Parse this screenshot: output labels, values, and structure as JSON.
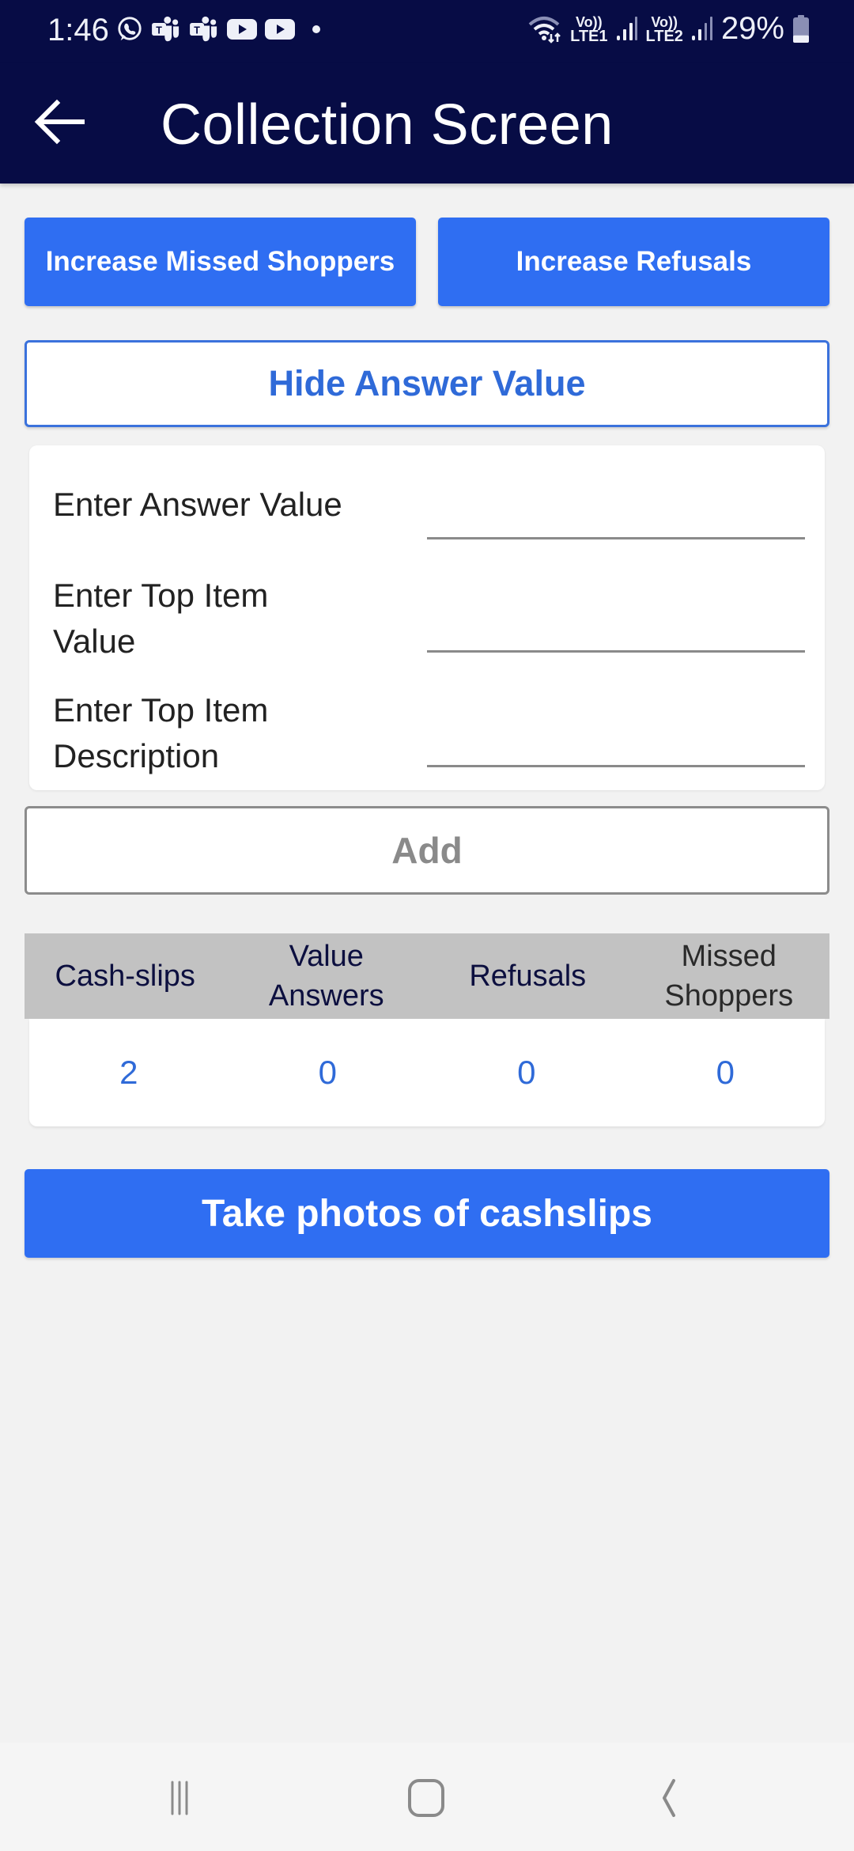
{
  "status_bar": {
    "time": "1:46",
    "notification_icons": [
      "whatsapp-icon",
      "teams-icon",
      "teams-icon",
      "youtube-icon",
      "youtube-icon",
      "more-notifications-dot"
    ],
    "wifi_icon": "wifi-icon",
    "sim1": {
      "top": "Vo))",
      "bottom": "LTE1"
    },
    "sim2": {
      "top": "Vo))",
      "bottom": "LTE2"
    },
    "battery_percent": "29%",
    "battery_level": 0.29
  },
  "app_bar": {
    "back_icon": "arrow-left-icon",
    "title": "Collection Screen"
  },
  "actions": {
    "increase_missed_shoppers": "Increase Missed Shoppers",
    "increase_refusals": "Increase Refusals",
    "hide_answer_value": "Hide Answer Value",
    "add": "Add",
    "take_photos": "Take photos of cashslips"
  },
  "form": {
    "fields": [
      {
        "label": "Enter Answer Value",
        "value": ""
      },
      {
        "label_line1": "Enter Top Item",
        "label_line2": "Value",
        "value": ""
      },
      {
        "label_line1": "Enter Top Item",
        "label_line2": "Description",
        "value": ""
      }
    ]
  },
  "stats": {
    "headers": [
      {
        "line1": "Cash-slips",
        "line2": ""
      },
      {
        "line1": "Value",
        "line2": "Answers"
      },
      {
        "line1": "Refusals",
        "line2": ""
      },
      {
        "line1": "Missed",
        "line2": "Shoppers"
      }
    ],
    "values": [
      "2",
      "0",
      "0",
      "0"
    ]
  },
  "colors": {
    "app_bar": "#070c45",
    "primary_button": "#2f6ef2",
    "accent_text": "#2f6ad8",
    "table_header": "#c2c2c2",
    "background": "#f2f2f2"
  },
  "nav_bar": {
    "buttons": [
      "recent-apps-icon",
      "home-icon",
      "back-icon"
    ]
  }
}
